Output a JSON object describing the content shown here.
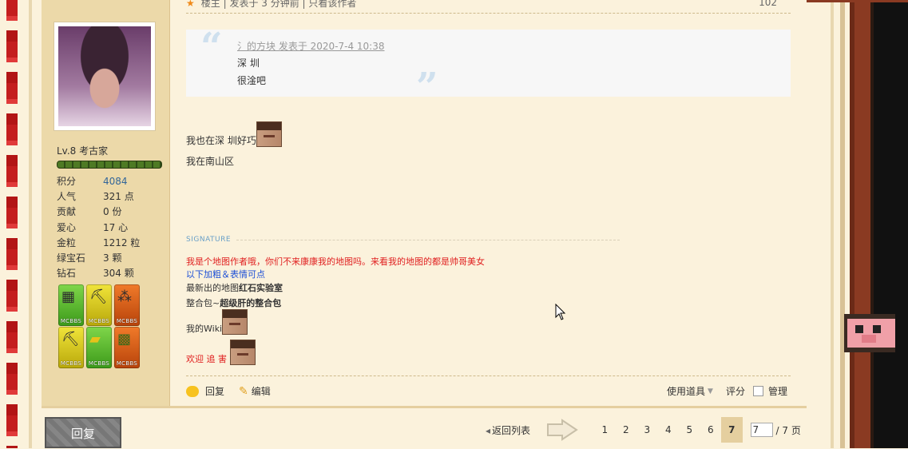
{
  "post_meta": {
    "top_line": "楼主 | 发表于 3 分钟前 | 只看该作者",
    "floor": "102"
  },
  "user": {
    "level": "Lv.8 考古家",
    "stats": [
      {
        "k": "积分",
        "v": "4084",
        "link": true
      },
      {
        "k": "人气",
        "v": "321 点"
      },
      {
        "k": "贡献",
        "v": "0 份"
      },
      {
        "k": "爱心",
        "v": "17 心"
      },
      {
        "k": "金粒",
        "v": "1212 粒"
      },
      {
        "k": "绿宝石",
        "v": "3 颗"
      },
      {
        "k": "钻石",
        "v": "304 颗"
      }
    ],
    "medal_tag": "MCBBS"
  },
  "quote": {
    "header": "氵的方块 发表于 2020-7-4 10:38",
    "line1": "深 圳",
    "line2": "很淦吧"
  },
  "message": {
    "line1": "我也在深 圳好巧",
    "line2": "我在南山区"
  },
  "signature": {
    "heading": "SIGNATURE",
    "line1": "我是个地图作者哦，你们不来康康我的地图吗。来看我的地图的都是帅哥美女",
    "line2": "以下加粗＆表情可点",
    "line3_prefix": "最新出的地图",
    "line3_bold": "红石实验室",
    "line4_prefix": "整合包~",
    "line4_bold": "超级肝的整合包",
    "line5": "我的Wiki",
    "line6": "欢迎 追 害"
  },
  "actions": {
    "reply": "回复",
    "edit": "编辑",
    "use_item": "使用道具",
    "rate": "评分",
    "manage": "管理"
  },
  "footer": {
    "reply_button": "回复",
    "back_to_list": "返回列表",
    "pages": [
      "1",
      "2",
      "3",
      "4",
      "5",
      "6",
      "7"
    ],
    "current_page": "7",
    "page_input": "7",
    "total": "/ 7 页"
  }
}
